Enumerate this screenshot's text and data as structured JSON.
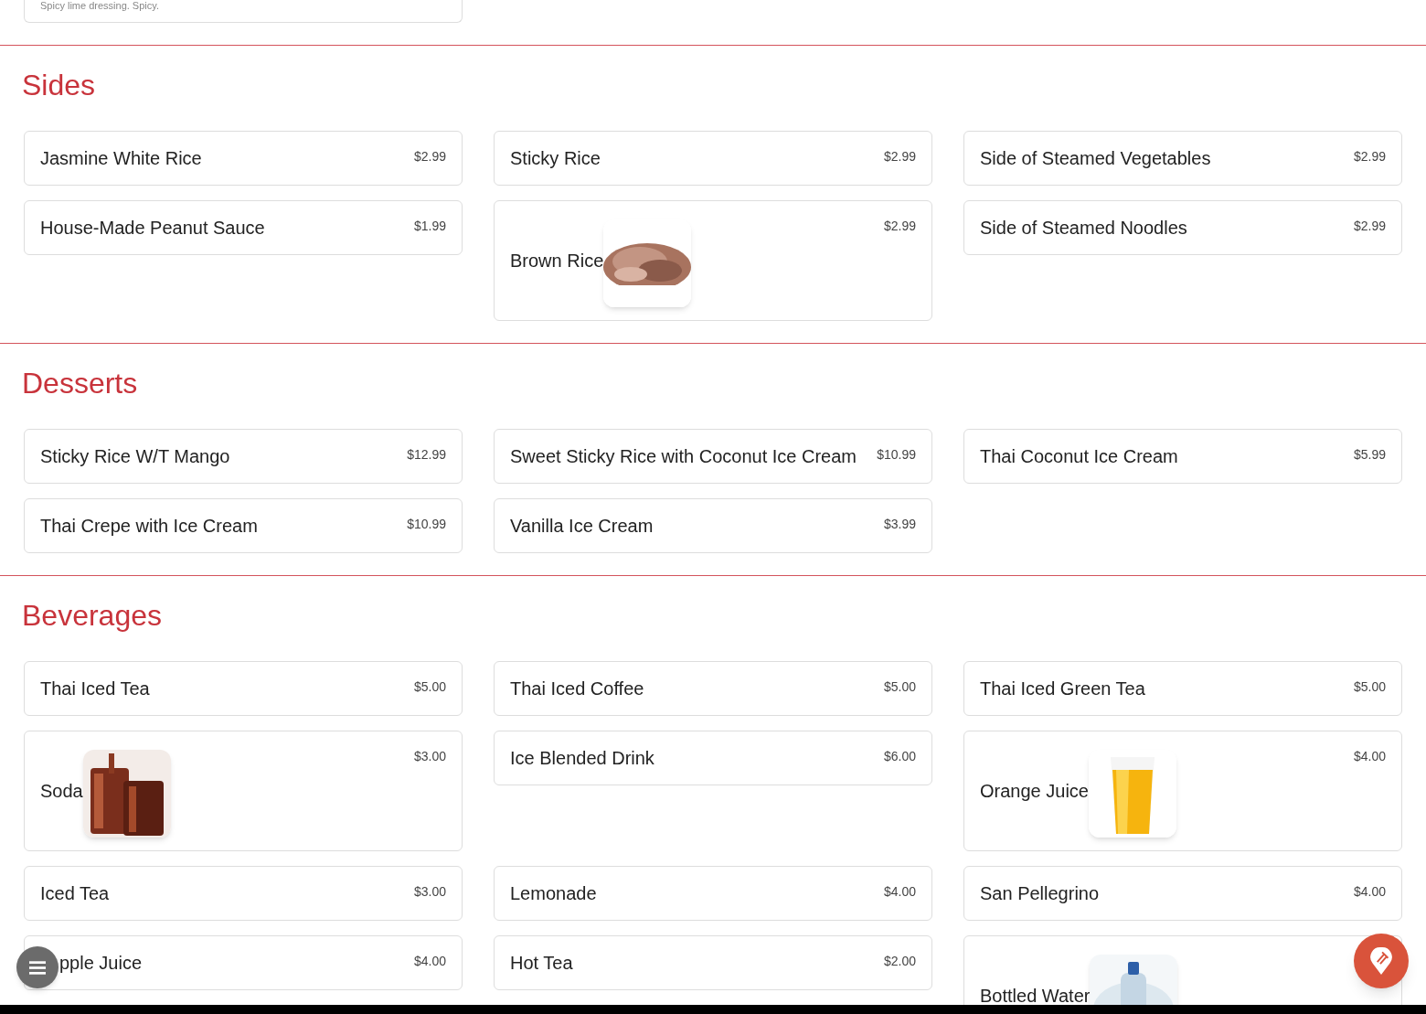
{
  "top_card": {
    "description": "Spicy lime dressing. Spicy."
  },
  "sections": [
    {
      "title": "Sides",
      "items": [
        {
          "name": "Jasmine White Rice",
          "price": "$2.99",
          "kind": "text"
        },
        {
          "name": "Sticky Rice",
          "price": "$2.99",
          "kind": "text"
        },
        {
          "name": "Side of Steamed Vegetables",
          "price": "$2.99",
          "kind": "text"
        },
        {
          "name": "House-Made Peanut Sauce",
          "price": "$1.99",
          "kind": "text"
        },
        {
          "name": "Brown Rice",
          "price": "$2.99",
          "kind": "picture"
        },
        {
          "name": "Side of Steamed Noodles",
          "price": "$2.99",
          "kind": "text"
        }
      ]
    },
    {
      "title": "Desserts",
      "items": [
        {
          "name": "Sticky Rice W/T Mango",
          "price": "$12.99",
          "kind": "text"
        },
        {
          "name": "Sweet Sticky Rice with Coconut Ice Cream",
          "price": "$10.99",
          "kind": "text"
        },
        {
          "name": "Thai Coconut Ice Cream",
          "price": "$5.99",
          "kind": "text"
        },
        {
          "name": "Thai Crepe with Ice Cream",
          "price": "$10.99",
          "kind": "text"
        },
        {
          "name": "Vanilla Ice Cream",
          "price": "$3.99",
          "kind": "text"
        }
      ]
    },
    {
      "title": "Beverages",
      "items": [
        {
          "name": "Thai Iced Tea",
          "price": "$5.00",
          "kind": "text"
        },
        {
          "name": "Thai Iced Coffee",
          "price": "$5.00",
          "kind": "text"
        },
        {
          "name": "Thai Iced Green Tea",
          "price": "$5.00",
          "kind": "text"
        },
        {
          "name": "Soda",
          "price": "$3.00",
          "kind": "picture"
        },
        {
          "name": "Ice Blended Drink",
          "price": "$6.00",
          "kind": "text"
        },
        {
          "name": "Orange Juice",
          "price": "$4.00",
          "kind": "picture"
        },
        {
          "name": "Iced Tea",
          "price": "$3.00",
          "kind": "text"
        },
        {
          "name": "Lemonade",
          "price": "$4.00",
          "kind": "text"
        },
        {
          "name": "San Pellegrino",
          "price": "$4.00",
          "kind": "text"
        },
        {
          "name": "pple Juice",
          "price": "$4.00",
          "kind": "covered"
        },
        {
          "name": "Hot Tea",
          "price": "$2.00",
          "kind": "text"
        },
        {
          "name": "Bottled Water",
          "kind": "picture"
        }
      ]
    }
  ]
}
